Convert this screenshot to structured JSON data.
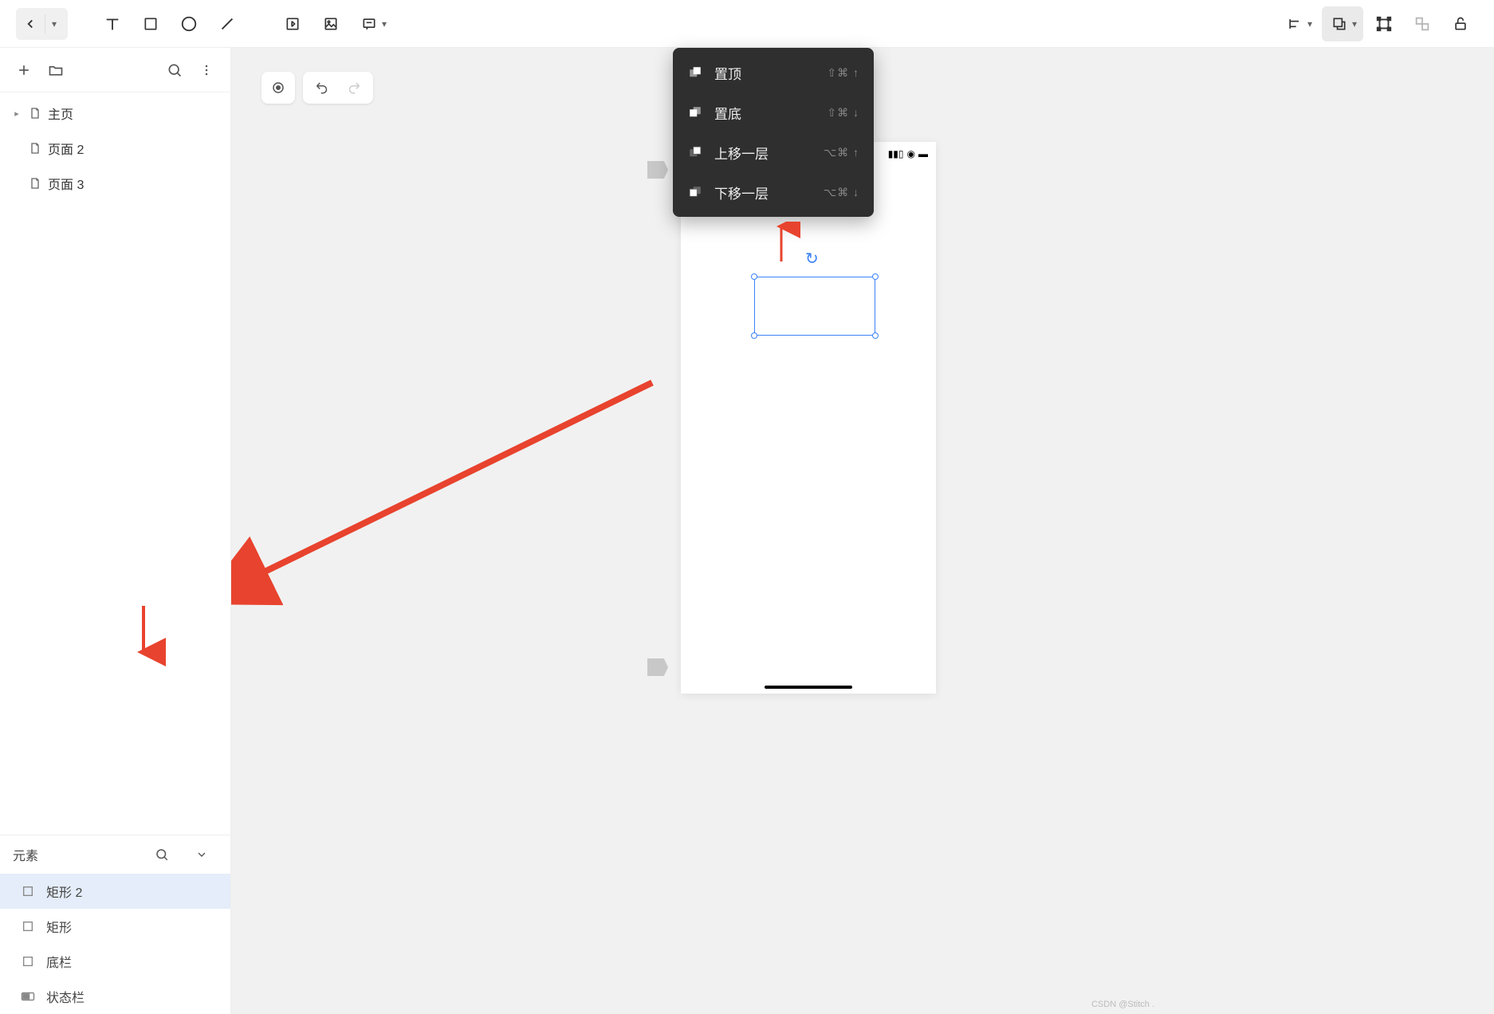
{
  "toolbar": {
    "back": "‹",
    "dropdown": "▾"
  },
  "pages": [
    {
      "label": "主页",
      "expandable": true
    },
    {
      "label": "页面 2",
      "expandable": false
    },
    {
      "label": "页面 3",
      "expandable": false
    }
  ],
  "layers": {
    "title": "元素",
    "items": [
      {
        "label": "矩形 2",
        "selected": true,
        "icon": "rect"
      },
      {
        "label": "矩形",
        "selected": false,
        "icon": "rect"
      },
      {
        "label": "底栏",
        "selected": false,
        "icon": "rect"
      },
      {
        "label": "状态栏",
        "selected": false,
        "icon": "bar"
      }
    ]
  },
  "arrange_menu": [
    {
      "label": "置顶",
      "shortcut": "⇧⌘ ↑",
      "icon": "front"
    },
    {
      "label": "置底",
      "shortcut": "⇧⌘ ↓",
      "icon": "back"
    },
    {
      "label": "上移一层",
      "shortcut": "⌥⌘ ↑",
      "icon": "up"
    },
    {
      "label": "下移一层",
      "shortcut": "⌥⌘ ↓",
      "icon": "down"
    }
  ],
  "watermark": "CSDN @Stitch ."
}
